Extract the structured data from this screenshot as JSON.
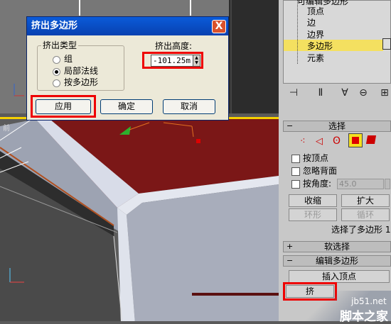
{
  "dialog": {
    "title": "挤出多边形",
    "close_label": "X",
    "group_title": "挤出类型",
    "options": [
      "组",
      "局部法线",
      "按多边形"
    ],
    "selected_option": "局部法线",
    "height_label": "挤出高度:",
    "height_value": "-101.25m",
    "apply_label": "应用",
    "ok_label": "确定",
    "cancel_label": "取消"
  },
  "tree": {
    "items": [
      "可编辑多边形",
      "顶点",
      "边",
      "边界",
      "多边形",
      "元素"
    ],
    "selected": "多边形"
  },
  "panel": {
    "select_rollout": "选择",
    "by_vertex": "按顶点",
    "ignore_backface": "忽略背面",
    "by_angle": "按角度:",
    "angle_value": "45.0",
    "shrink": "收缩",
    "grow": "扩大",
    "ring": "环形",
    "loop": "循环",
    "status": "选择了多边形 1",
    "soft_select": "软选择",
    "edit_poly": "编辑多边形",
    "insert_vertex": "插入顶点",
    "extrude_partial": "挤"
  },
  "viewport": {
    "label": "前"
  },
  "watermark": {
    "site": "jb51.net",
    "name": "脚本之家"
  },
  "colors": {
    "highlight": "#e00000",
    "title_bar": "#0a5bd9",
    "selection": "#f4e060",
    "polygon_fill": "#7a1a1a"
  }
}
